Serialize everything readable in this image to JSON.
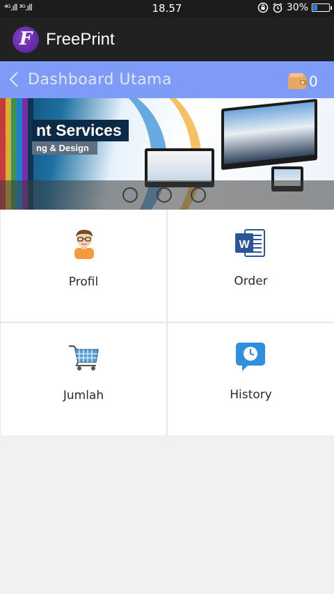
{
  "status_bar": {
    "signal": "⁴ᴳ.ıll ³ᴳ.ıll",
    "time": "18.57",
    "battery_percent": "30%",
    "battery_level": 0.3
  },
  "app_bar": {
    "logo_letter": "F",
    "title": "FreePrint"
  },
  "header": {
    "title": "Dashboard Utama",
    "wallet_count": "0"
  },
  "banner": {
    "heading": "nt Services",
    "subheading": "ng & Design",
    "slide_count": 3
  },
  "menu": {
    "items": [
      {
        "label": "Profil",
        "icon": "user-avatar-icon"
      },
      {
        "label": "Order",
        "icon": "word-document-icon"
      },
      {
        "label": "Jumlah",
        "icon": "shopping-cart-icon"
      },
      {
        "label": "History",
        "icon": "clock-chat-icon"
      }
    ]
  },
  "colors": {
    "header_bg": "#7f9bf8",
    "app_bar_bg": "#212121",
    "status_bar_bg": "#1c1c1c",
    "page_bg": "#f1f1f1"
  }
}
